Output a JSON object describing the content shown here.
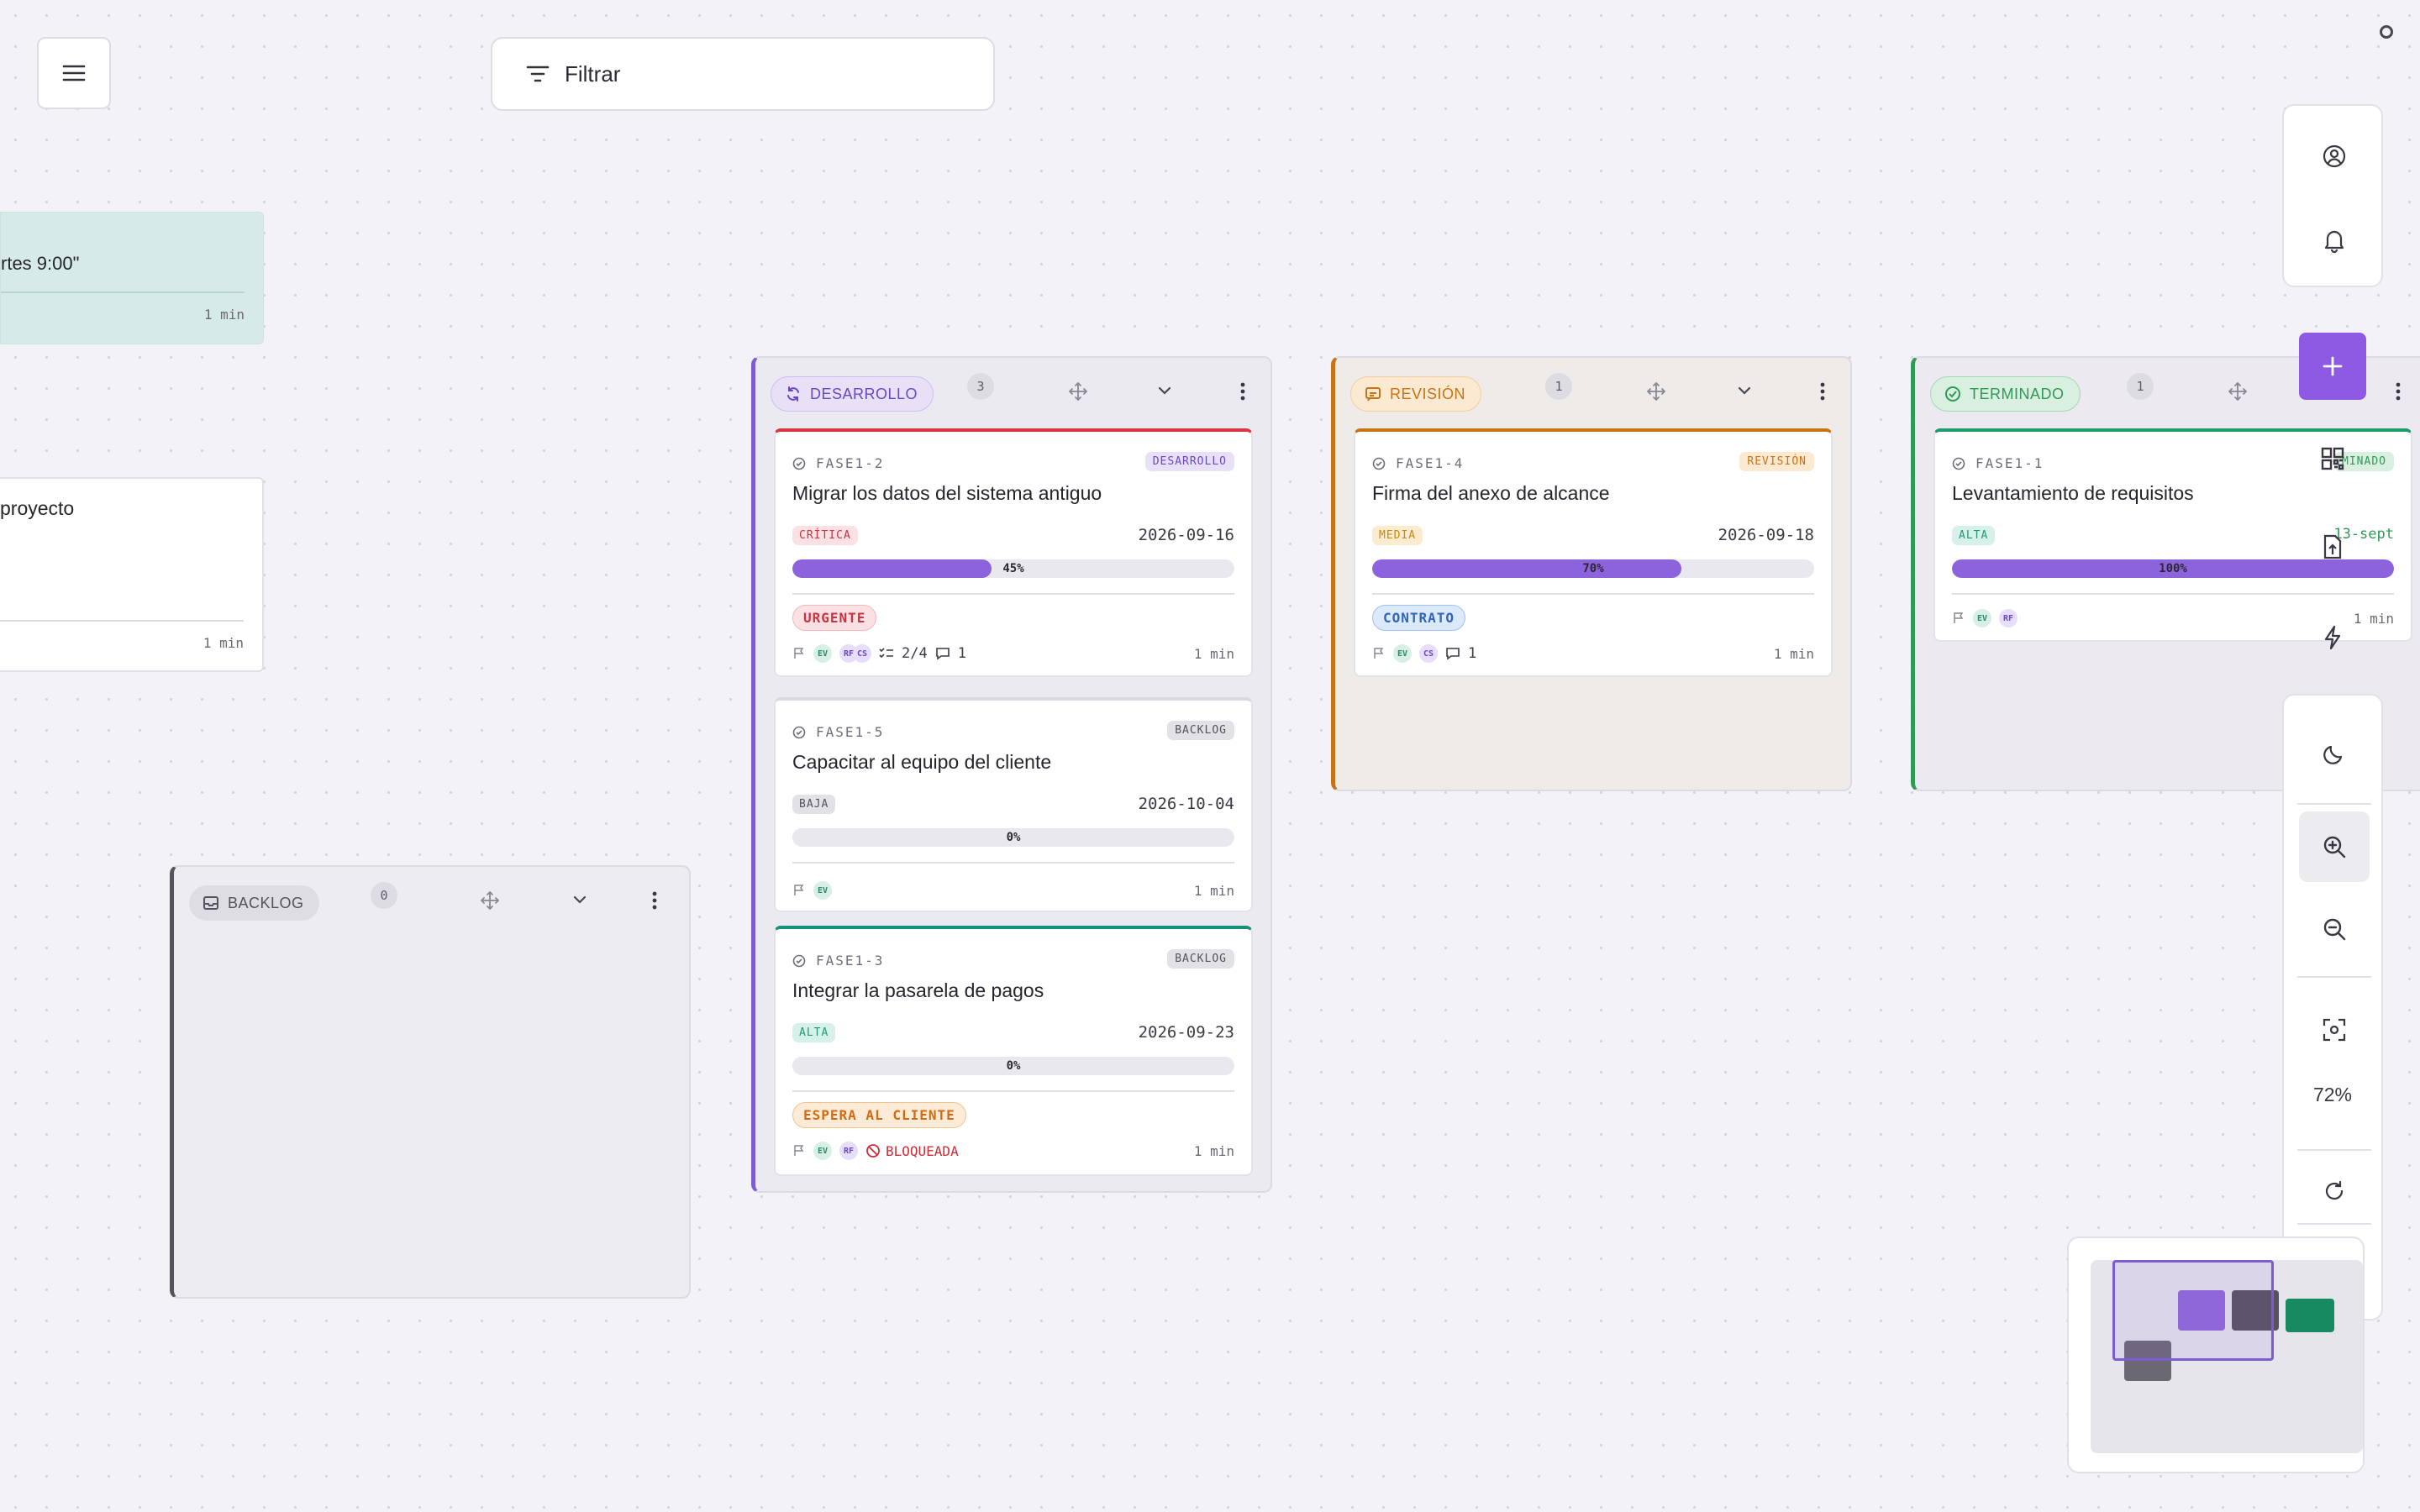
{
  "toolbar": {
    "filter_label": "Filtrar",
    "zoom_level": "72%"
  },
  "stray_cards": {
    "note_text": "rtes 9:00\"",
    "note_time": "1 min",
    "doc_text": "proyecto",
    "doc_time": "1 min"
  },
  "columns": {
    "backlog": {
      "label": "BACKLOG",
      "count": "0"
    },
    "desarrollo": {
      "label": "DESARROLLO",
      "count": "3",
      "cards": [
        {
          "id": "FASE1-2",
          "status": "DESARROLLO",
          "title": "Migrar los datos del sistema antiguo",
          "priority": "CRÍTICA",
          "date": "2026-09-16",
          "progress": 45,
          "progress_label": "45%",
          "label": "URGENTE",
          "checklist": "2/4",
          "comments": "1",
          "time": "1 min"
        },
        {
          "id": "FASE1-5",
          "status": "BACKLOG",
          "title": "Capacitar al equipo del cliente",
          "priority": "BAJA",
          "date": "2026-10-04",
          "progress": 0,
          "progress_label": "0%",
          "time": "1 min"
        },
        {
          "id": "FASE1-3",
          "status": "BACKLOG",
          "title": "Integrar la pasarela de pagos",
          "priority": "ALTA",
          "date": "2026-09-23",
          "progress": 0,
          "progress_label": "0%",
          "label": "ESPERA AL CLIENTE",
          "blocked": "BLOQUEADA",
          "time": "1 min"
        }
      ]
    },
    "revision": {
      "label": "REVISIÓN",
      "count": "1",
      "cards": [
        {
          "id": "FASE1-4",
          "status": "REVISIÓN",
          "title": "Firma del anexo de alcance",
          "priority": "MEDIA",
          "date": "2026-09-18",
          "progress": 70,
          "progress_label": "70%",
          "label": "CONTRATO",
          "comments": "1",
          "time": "1 min"
        }
      ]
    },
    "terminado": {
      "label": "TERMINADO",
      "count": "1",
      "cards": [
        {
          "id": "FASE1-1",
          "status": "MINADO",
          "title": "Levantamiento de requisitos",
          "priority": "ALTA",
          "date": "13-sept",
          "progress": 100,
          "progress_label": "100%",
          "time": "1 min"
        }
      ]
    }
  },
  "avatars": {
    "ev": "EV",
    "rf": "RF",
    "cs": "CS"
  },
  "colors": {
    "accent": "#8e5ae3",
    "desarrollo": "#7d5bd0",
    "revision": "#c87314",
    "terminado": "#2f9a55",
    "backlog": "#55525c",
    "danger": "#d12b35"
  },
  "icons": {
    "menu": "hamburger-icon",
    "filter": "filter-icon",
    "user": "user-circle-icon",
    "bell": "bell-icon",
    "add": "plus-icon",
    "qr": "qr-icon",
    "upload": "file-upload-icon",
    "bolt": "lightning-icon",
    "moon": "moon-icon",
    "zoom_in": "zoom-in-icon",
    "zoom_out": "zoom-out-icon",
    "fit": "fit-screen-icon",
    "refresh": "refresh-icon",
    "layers": "layers-icon"
  }
}
